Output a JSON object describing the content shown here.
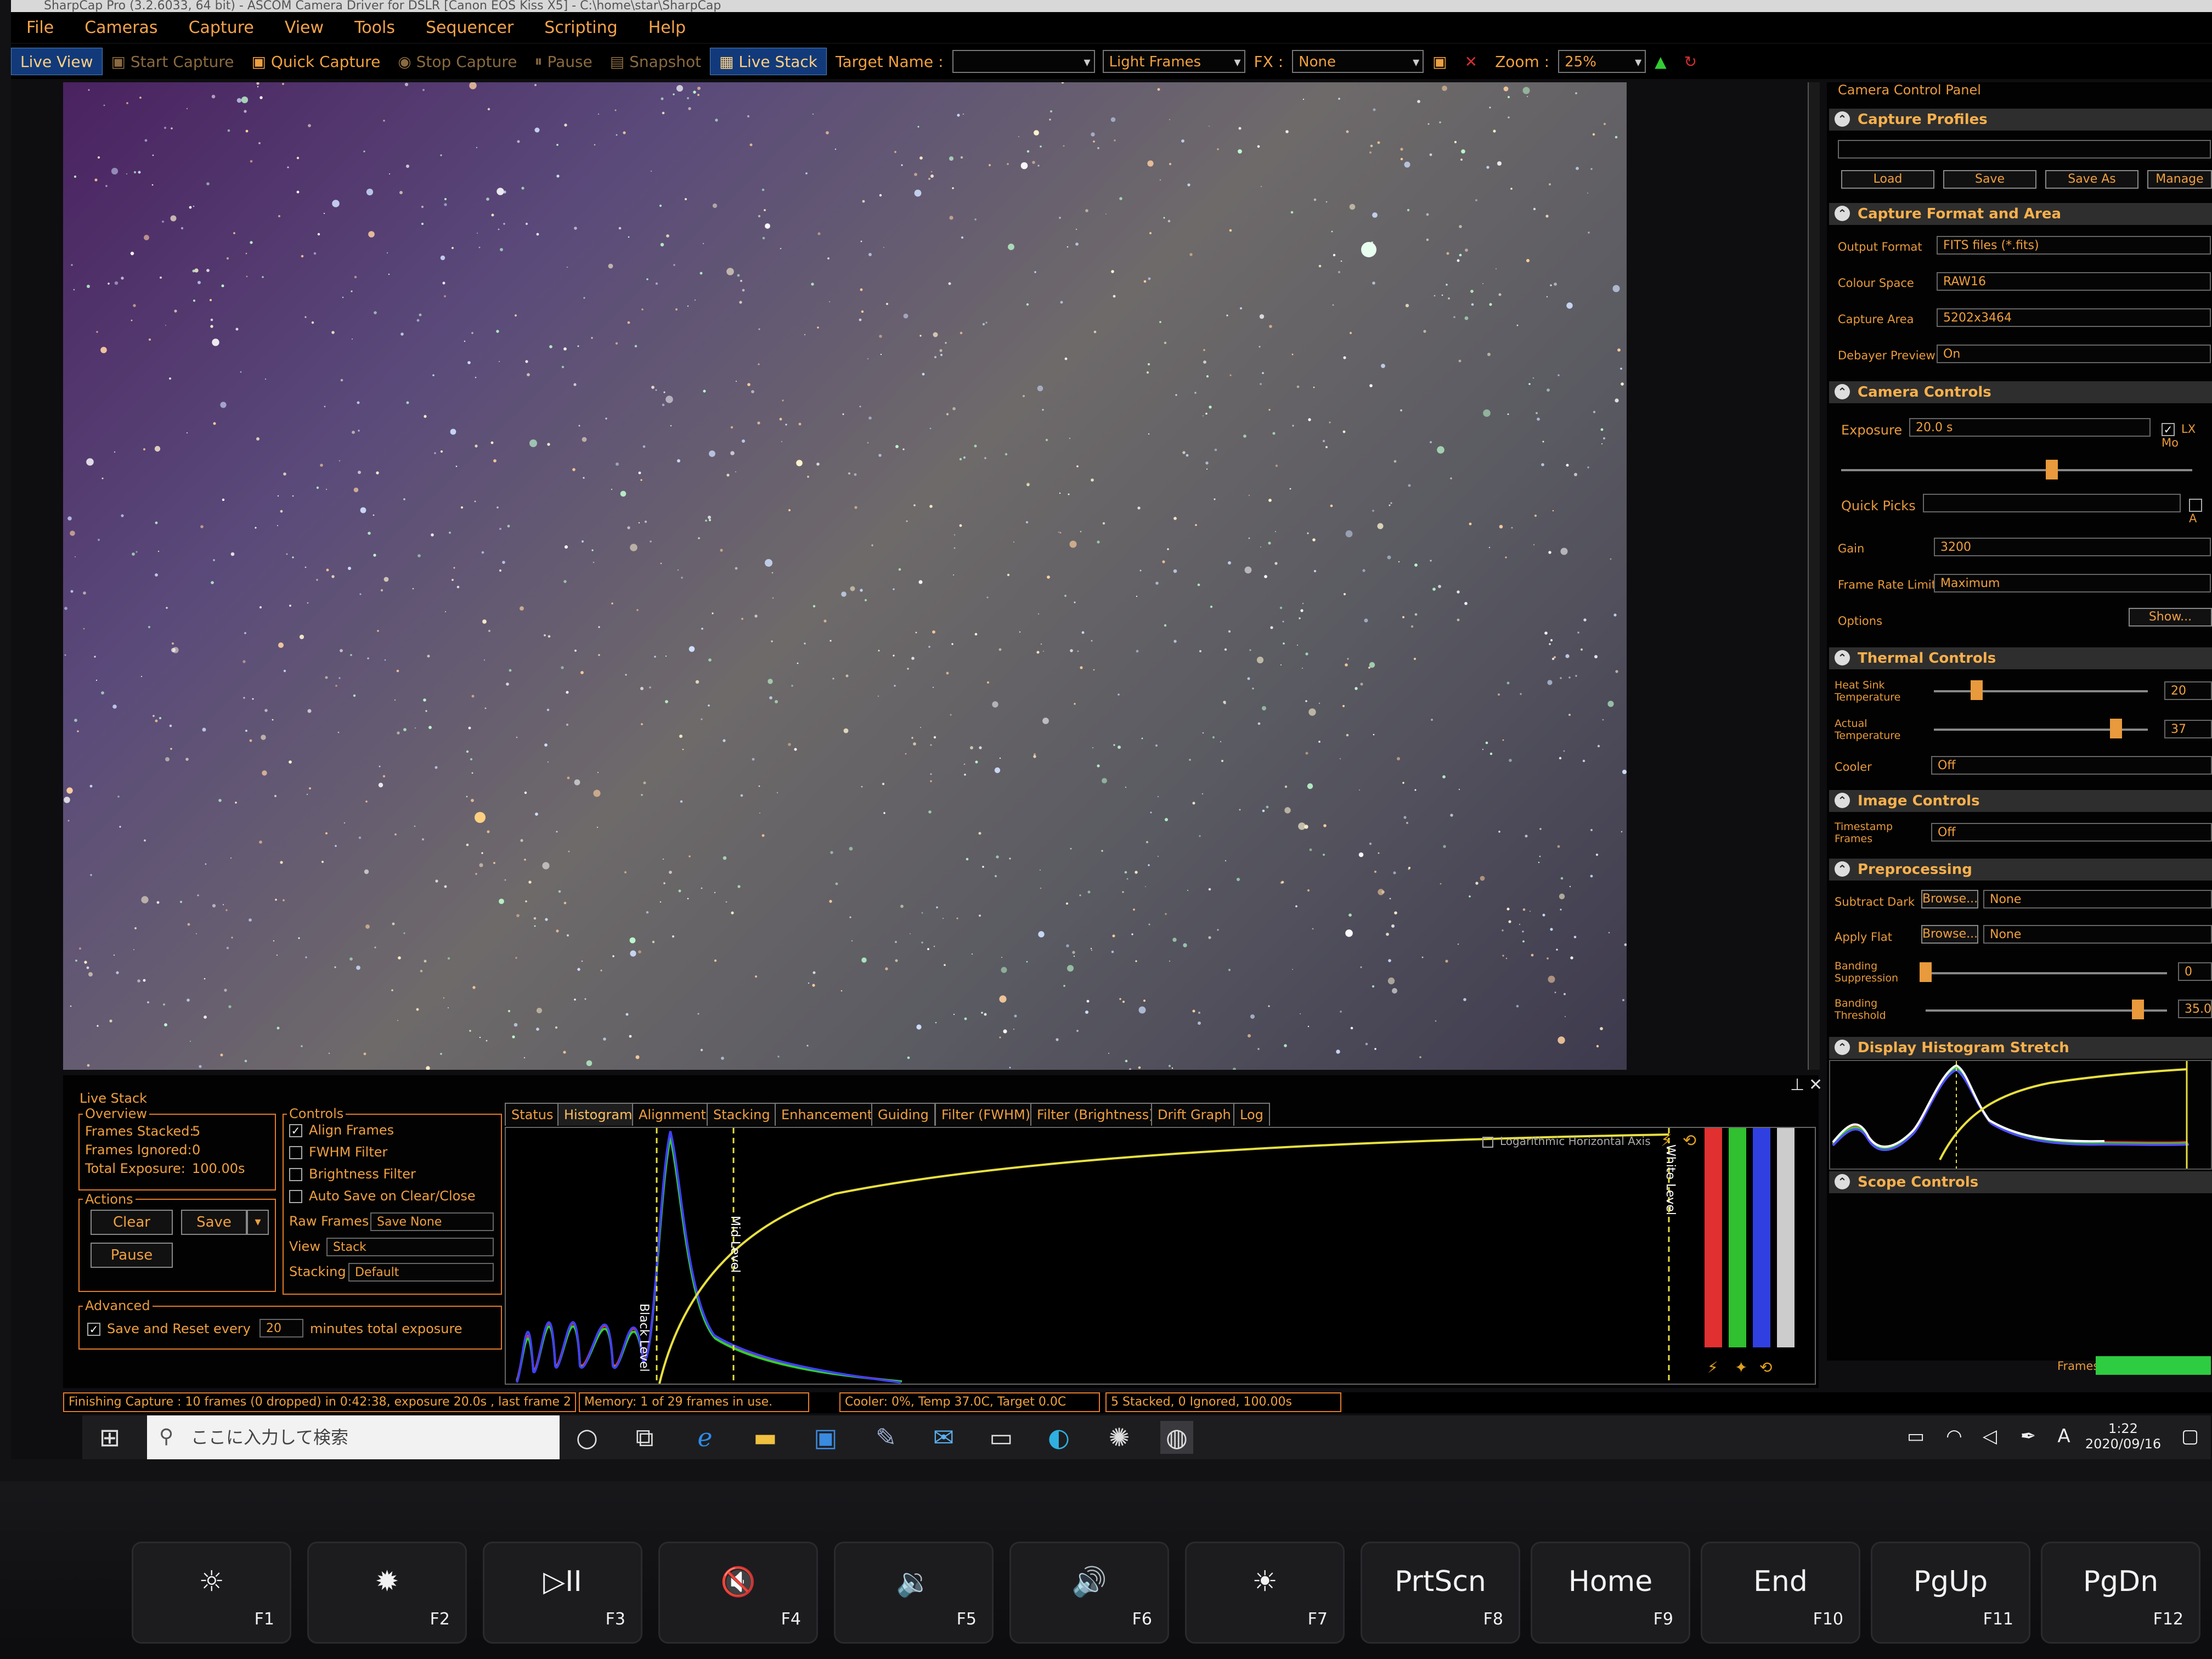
{
  "window": {
    "title": "SharpCap Pro (3.2.6033, 64 bit) - ASCOM Camera Driver for DSLR [Canon EOS Kiss X5] - C:\\home\\star\\SharpCap"
  },
  "menu": [
    "File",
    "Cameras",
    "Capture",
    "View",
    "Tools",
    "Sequencer",
    "Scripting",
    "Help"
  ],
  "toolbar": {
    "live_view": "Live View",
    "start_capture": "Start Capture",
    "quick_capture": "Quick Capture",
    "stop_capture": "Stop Capture",
    "pause": "Pause",
    "snapshot": "Snapshot",
    "live_stack": "Live Stack",
    "target_label": "Target Name :",
    "target_value": "",
    "frame_type": "Light Frames",
    "fx_label": "FX :",
    "fx_value": "None",
    "zoom_label": "Zoom :",
    "zoom_value": "25%"
  },
  "panel": {
    "title": "Camera Control Panel",
    "capture_profiles": {
      "title": "Capture Profiles",
      "load": "Load",
      "save": "Save",
      "save_as": "Save As",
      "manage": "Manage"
    },
    "capture_format": {
      "title": "Capture Format and Area",
      "output_format_label": "Output Format",
      "output_format": "FITS files (*.fits)",
      "colour_space_label": "Colour Space",
      "colour_space": "RAW16",
      "capture_area_label": "Capture Area",
      "capture_area": "5202x3464",
      "debayer_label": "Debayer Preview",
      "debayer": "On"
    },
    "camera_controls": {
      "title": "Camera Controls",
      "exposure_label": "Exposure",
      "exposure": "20.0 s",
      "lx_mode": "LX Mo",
      "exposure_slider": 0.6,
      "quick_picks_label": "Quick Picks",
      "quick_picks": "",
      "quick_picks_check": "A",
      "gain_label": "Gain",
      "gain": "3200",
      "frame_rate_label": "Frame Rate Limit",
      "frame_rate": "Maximum",
      "options_label": "Options",
      "show": "Show..."
    },
    "thermal": {
      "title": "Thermal Controls",
      "heat_sink_label1": "Heat Sink",
      "heat_sink_label2": "Temperature",
      "heat_sink_value": "20",
      "heat_sink_slider": 0.2,
      "actual_label1": "Actual",
      "actual_label2": "Temperature",
      "actual_value": "37",
      "actual_slider": 0.85,
      "cooler_label": "Cooler",
      "cooler": "Off"
    },
    "image_controls": {
      "title": "Image Controls",
      "timestamp_label1": "Timestamp",
      "timestamp_label2": "Frames",
      "timestamp": "Off"
    },
    "preprocessing": {
      "title": "Preprocessing",
      "dark_label": "Subtract Dark",
      "browse": "Browse...",
      "dark_value": "None",
      "flat_label": "Apply Flat",
      "flat_value": "None",
      "banding_supp_label1": "Banding",
      "banding_supp_label2": "Suppression",
      "banding_supp_value": "0",
      "banding_supp_slider": 0.0,
      "banding_thr_label1": "Banding",
      "banding_thr_label2": "Threshold",
      "banding_thr_value": "35.0",
      "banding_thr_slider": 0.88
    },
    "display_histogram": {
      "title": "Display Histogram Stretch"
    },
    "scope_controls": {
      "title": "Scope Controls"
    }
  },
  "livestack": {
    "title": "Live Stack",
    "overview_title": "Overview",
    "frames_stacked_label": "Frames Stacked:",
    "frames_stacked": "5",
    "frames_ignored_label": "Frames Ignored:",
    "frames_ignored": "0",
    "total_exposure_label": "Total Exposure:",
    "total_exposure": "100.00s",
    "actions_title": "Actions",
    "clear": "Clear",
    "save": "Save",
    "pause": "Pause",
    "controls_title": "Controls",
    "align_frames": "Align Frames",
    "fwhm_filter": "FWHM Filter",
    "brightness_filter": "Brightness Filter",
    "auto_save": "Auto Save on Clear/Close",
    "raw_frames_label": "Raw Frames",
    "raw_frames": "Save None",
    "view_label": "View",
    "view": "Stack",
    "stacking_label": "Stacking",
    "stacking": "Default",
    "advanced_title": "Advanced",
    "save_reset_label": "Save and Reset every",
    "save_reset_value": "20",
    "save_reset_unit": "minutes total exposure",
    "tabs": [
      "Status",
      "Histogram",
      "Alignment",
      "Stacking",
      "Enhancement",
      "Guiding",
      "Filter (FWHM)",
      "Filter (Brightness)",
      "Drift Graph",
      "Log"
    ],
    "log_axis": "Logarithmic Horizontal Axis",
    "black_level": "Black Level",
    "mid_level": "Mid Level",
    "white_level": "White Level"
  },
  "status": {
    "message": "Finishing Capture : 10 frames (0 dropped) in 0:42:38, exposure 20.0s , last frame 2",
    "memory": "Memory: 1 of 29 frames in use.",
    "cooler": "Cooler: 0%, Temp 37.0C, Target 0.0C",
    "stacked": "5 Stacked, 0 Ignored, 100.00s",
    "frames_label": "Frames"
  },
  "taskbar": {
    "search_placeholder": "ここに入力して検索",
    "time": "1:22",
    "date": "2020/09/16",
    "ime": "A"
  },
  "keys": [
    {
      "glyph": "☼",
      "fn": "F1"
    },
    {
      "glyph": "✹",
      "fn": "F2"
    },
    {
      "glyph": "▷II",
      "fn": "F3"
    },
    {
      "glyph": "🔇",
      "fn": "F4"
    },
    {
      "glyph": "🔉",
      "fn": "F5"
    },
    {
      "glyph": "🔊",
      "fn": "F6"
    },
    {
      "glyph": "☀",
      "fn": "F7"
    },
    {
      "glyph": "PrtScn",
      "fn": "F8"
    },
    {
      "glyph": "Home",
      "fn": "F9"
    },
    {
      "glyph": "End",
      "fn": "F10"
    },
    {
      "glyph": "PgUp",
      "fn": "F11"
    },
    {
      "glyph": "PgDn",
      "fn": "F12"
    }
  ],
  "colors": {
    "accent": "#f0a040",
    "border": "#e07a2a",
    "live_stack_active": "#123a7a",
    "frames_bar": "#2ecc40"
  }
}
